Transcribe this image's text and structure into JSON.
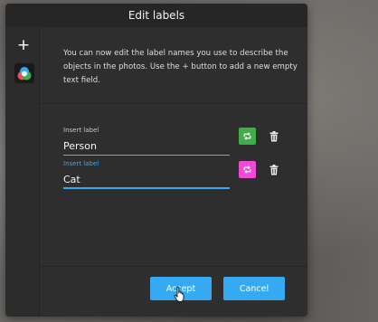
{
  "dialog": {
    "title": "Edit labels",
    "description": "You can now edit the label names you use to describe the objects in the photos. Use the + button to add a new empty text field."
  },
  "sidebar": {
    "add_symbol": "+",
    "tool_icon": "color-swatch-icon"
  },
  "labels": [
    {
      "caption": "Insert label",
      "value": "Person",
      "color": "#3fae49",
      "color_icon": "refresh-icon",
      "delete_icon": "trash-icon",
      "focused": false
    },
    {
      "caption": "Insert label",
      "value": "Cat",
      "color": "#f04ad6",
      "color_icon": "refresh-icon",
      "delete_icon": "trash-icon",
      "focused": true
    }
  ],
  "buttons": {
    "accept": "Accept",
    "cancel": "Cancel"
  },
  "colors": {
    "accent": "#35a9f2",
    "dialog_bg": "#2e2e2e"
  }
}
